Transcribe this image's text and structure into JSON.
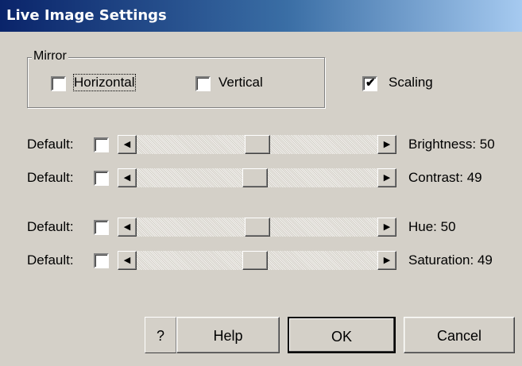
{
  "window": {
    "title": "Live Image Settings"
  },
  "mirror": {
    "legend": "Mirror",
    "horizontal": {
      "label": "Horizontal",
      "checked": false
    },
    "vertical": {
      "label": "Vertical",
      "checked": false
    }
  },
  "scaling": {
    "label": "Scaling",
    "checked": true
  },
  "sliders": [
    {
      "default_label": "Default:",
      "default_checked": false,
      "value_text": "Brightness: 50",
      "value": 50
    },
    {
      "default_label": "Default:",
      "default_checked": false,
      "value_text": "Contrast: 49",
      "value": 49
    },
    {
      "default_label": "Default:",
      "default_checked": false,
      "value_text": "Hue: 50",
      "value": 50
    },
    {
      "default_label": "Default:",
      "default_checked": false,
      "value_text": "Saturation: 49",
      "value": 49
    }
  ],
  "buttons": {
    "help_icon": "?",
    "help": "Help",
    "ok": "OK",
    "cancel": "Cancel"
  },
  "colors": {
    "titlebar_start": "#0a246a",
    "titlebar_end": "#a6caf0",
    "dialog": "#d4d0c8"
  }
}
